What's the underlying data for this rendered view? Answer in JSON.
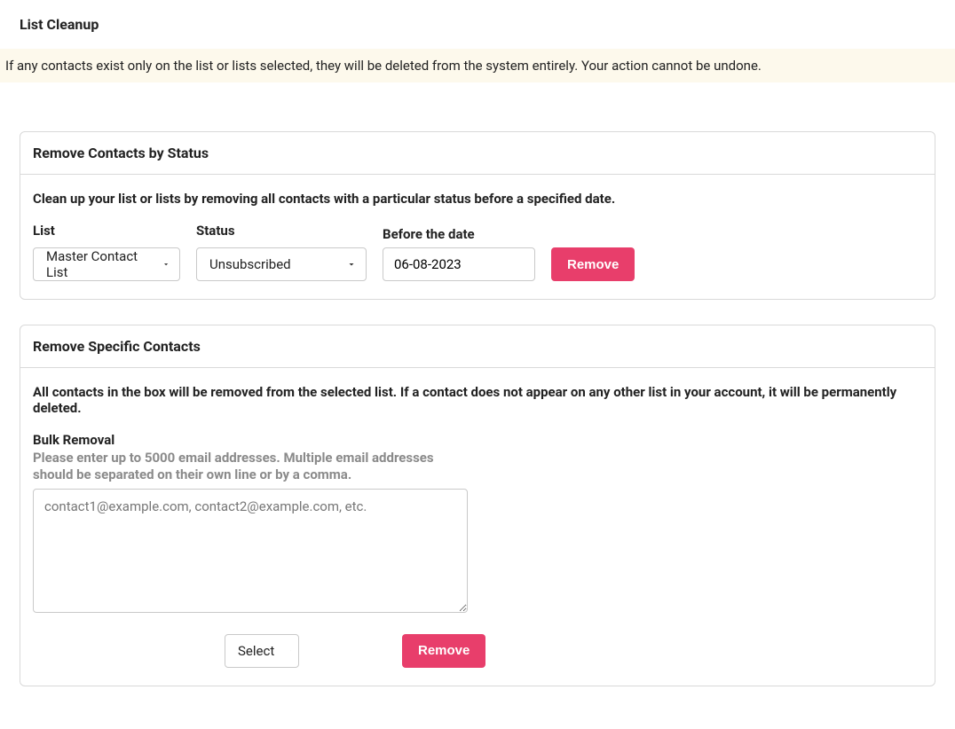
{
  "page": {
    "title": "List Cleanup"
  },
  "warning": "If any contacts exist only on the list or lists selected, they will be deleted from the system entirely. Your action cannot be undone.",
  "status_panel": {
    "title": "Remove Contacts by Status",
    "description": "Clean up your list or lists by removing all contacts with a particular status before a specified date.",
    "list_label": "List",
    "list_value": "Master Contact List",
    "status_label": "Status",
    "status_value": "Unsubscribed",
    "date_label": "Before the date",
    "date_value": "06-08-2023",
    "remove_label": "Remove"
  },
  "specific_panel": {
    "title": "Remove Specific Contacts",
    "description": "All contacts in the box will be removed from the selected list. If a contact does not appear on any other list in your account, it will be permanently deleted.",
    "bulk_label": "Bulk Removal",
    "bulk_hint": "Please enter up to 5000 email addresses. Multiple email addresses should be separated on their own line or by a comma.",
    "bulk_placeholder": "contact1@example.com, contact2@example.com, etc.",
    "select_value": "Select",
    "remove_label": "Remove"
  }
}
